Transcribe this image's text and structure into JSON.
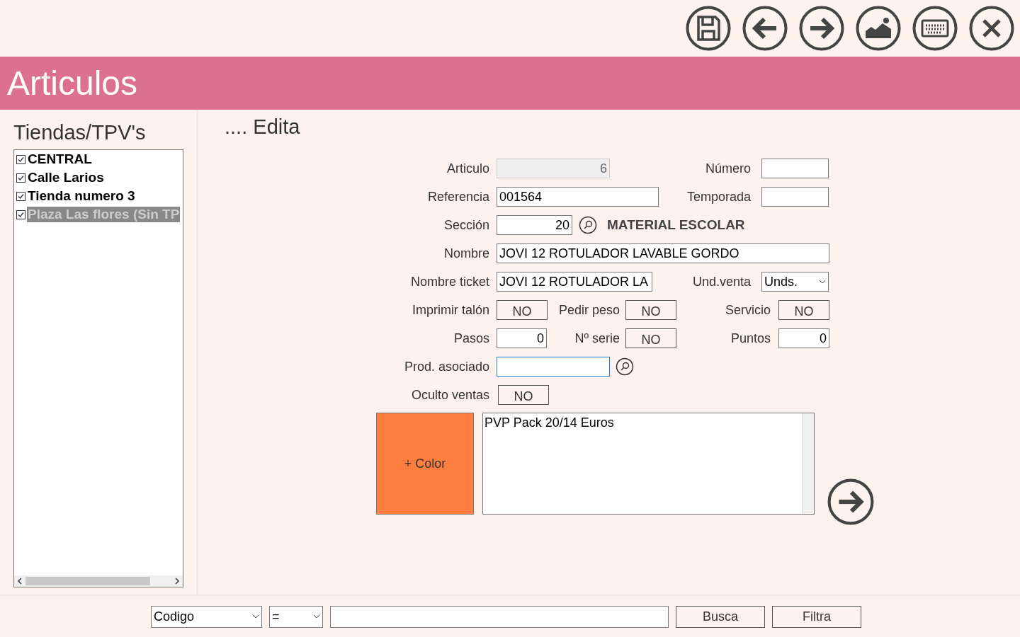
{
  "toolbar": {
    "buttons": [
      {
        "kind": "save"
      },
      {
        "kind": "back"
      },
      {
        "kind": "forward"
      },
      {
        "kind": "image"
      },
      {
        "kind": "keyboard"
      },
      {
        "kind": "close"
      }
    ]
  },
  "header": {
    "title": "Articulos"
  },
  "sidebar": {
    "title": "Tiendas/TPV's",
    "items": [
      {
        "label": "CENTRAL",
        "checked": true,
        "selected": false
      },
      {
        "label": "Calle Larios",
        "checked": true,
        "selected": false
      },
      {
        "label": "Tienda numero 3",
        "checked": true,
        "selected": false
      },
      {
        "label": "Plaza Las flores (Sin TP",
        "checked": true,
        "selected": true
      }
    ]
  },
  "form": {
    "mode": ".... Edita",
    "articulo": {
      "label": "Articulo",
      "value": "6",
      "disabled": true
    },
    "numero": {
      "label": "Número"
    },
    "referencia": {
      "label": "Referencia",
      "value": "001564"
    },
    "temporada": {
      "label": "Temporada"
    },
    "seccion": {
      "label": "Sección",
      "value": "20",
      "description": "MATERIAL ESCOLAR"
    },
    "nombre": {
      "label": "Nombre",
      "value": "JOVI 12 ROTULADOR LAVABLE GORDO"
    },
    "nombre_ticket": {
      "label": "Nombre ticket",
      "value": "JOVI 12 ROTULADOR LA"
    },
    "und_venta": {
      "label": "Und.venta",
      "value": "Unds."
    },
    "imprimir_talon": {
      "label": "Imprimir talón",
      "value": "NO"
    },
    "pedir_peso": {
      "label": "Pedir peso",
      "value": "NO"
    },
    "servicio": {
      "label": "Servicio",
      "value": "NO"
    },
    "pasos": {
      "label": "Pasos",
      "value": "0"
    },
    "n_serie": {
      "label": "Nº serie",
      "value": "NO"
    },
    "puntos": {
      "label": "Puntos",
      "value": "0"
    },
    "prod_asociado": {
      "label": "Prod. asociado",
      "focused": true
    },
    "oculto_ventas": {
      "label": "Oculto ventas",
      "value": "NO"
    },
    "color_button": {
      "label": "+ Color",
      "color": "#ff7f40"
    },
    "notes": "PVP Pack 20/14 Euros"
  },
  "search_bar": {
    "field": "Codigo",
    "operator": "=",
    "buttons": [
      "Busca",
      "Filtra"
    ]
  }
}
